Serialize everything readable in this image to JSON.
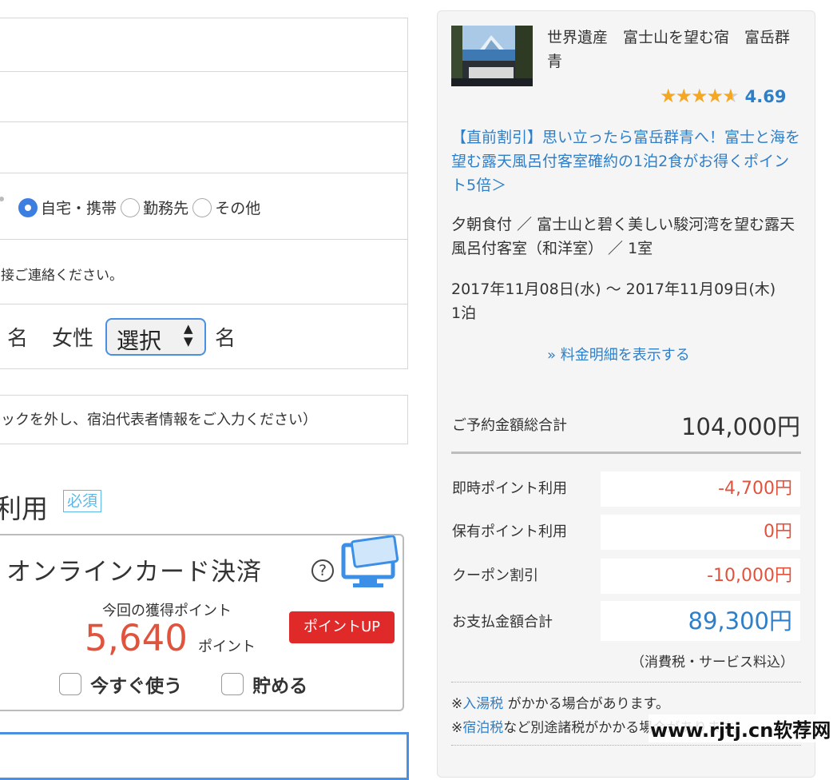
{
  "form": {
    "phone_type_options": [
      {
        "label": "自宅・携帯",
        "selected": true
      },
      {
        "label": "勤務先",
        "selected": false
      },
      {
        "label": "その他",
        "selected": false
      }
    ],
    "contact_note": "接ご連絡ください。",
    "guests": {
      "male_unit": "名",
      "female_label": "女性",
      "female_select_value": "選択",
      "female_unit": "名"
    },
    "representative_note": "ックを外し、宿泊代表者情報をご入力ください）",
    "section_title": "利用",
    "required_badge": "必須",
    "payment": {
      "title": "オンラインカード決済",
      "help_icon": "?",
      "points_label": "今回の獲得ポイント",
      "points_value": "5,640",
      "points_unit": "ポイント",
      "point_up_badge": "ポイントUP",
      "use_now_label": "今すぐ使う",
      "save_label": "貯める"
    }
  },
  "summary": {
    "hotel_name": "世界遺産　富士山を望む宿　富岳群青",
    "rating_value": "4.69",
    "rating_stars": 4.69,
    "plan_title": "【直前割引】思い立ったら富岳群青へ！富士と海を望む露天風呂付客室確約の1泊2食がお得くポイント5倍＞",
    "plan_details": "夕朝食付 ／ 富士山と碧く美しい駿河湾を望む露天風呂付客室（和洋室） ／ 1室",
    "dates": "2017年11月08日(水) 〜 2017年11月09日(木)",
    "nights": "1泊",
    "fee_detail_link": "» 料金明細を表示する",
    "total_label": "ご予約金額総合計",
    "total_value": "104,000円",
    "lines": [
      {
        "label": "即時ポイント利用",
        "value": "-4,700円"
      },
      {
        "label": "保有ポイント利用",
        "value": "0円"
      },
      {
        "label": "クーポン割引",
        "value": "-10,000円"
      }
    ],
    "payment_label": "お支払金額合計",
    "payment_value": "89,300円",
    "tax_note": "（消費税・サービス料込）",
    "notes": [
      {
        "prefix": "※",
        "link": "入湯税",
        "text": " がかかる場合があります。"
      },
      {
        "prefix": "※",
        "link": "宿泊税",
        "text": "など別途諸税がかかる場合があります。"
      }
    ]
  },
  "watermark": "www.rjtj.cn软荐网",
  "colors": {
    "accent": "#2f7fc8",
    "price_red": "#e0533d",
    "badge_red": "#e02a2a",
    "select_border": "#4a90e2",
    "star": "#f5a623"
  }
}
